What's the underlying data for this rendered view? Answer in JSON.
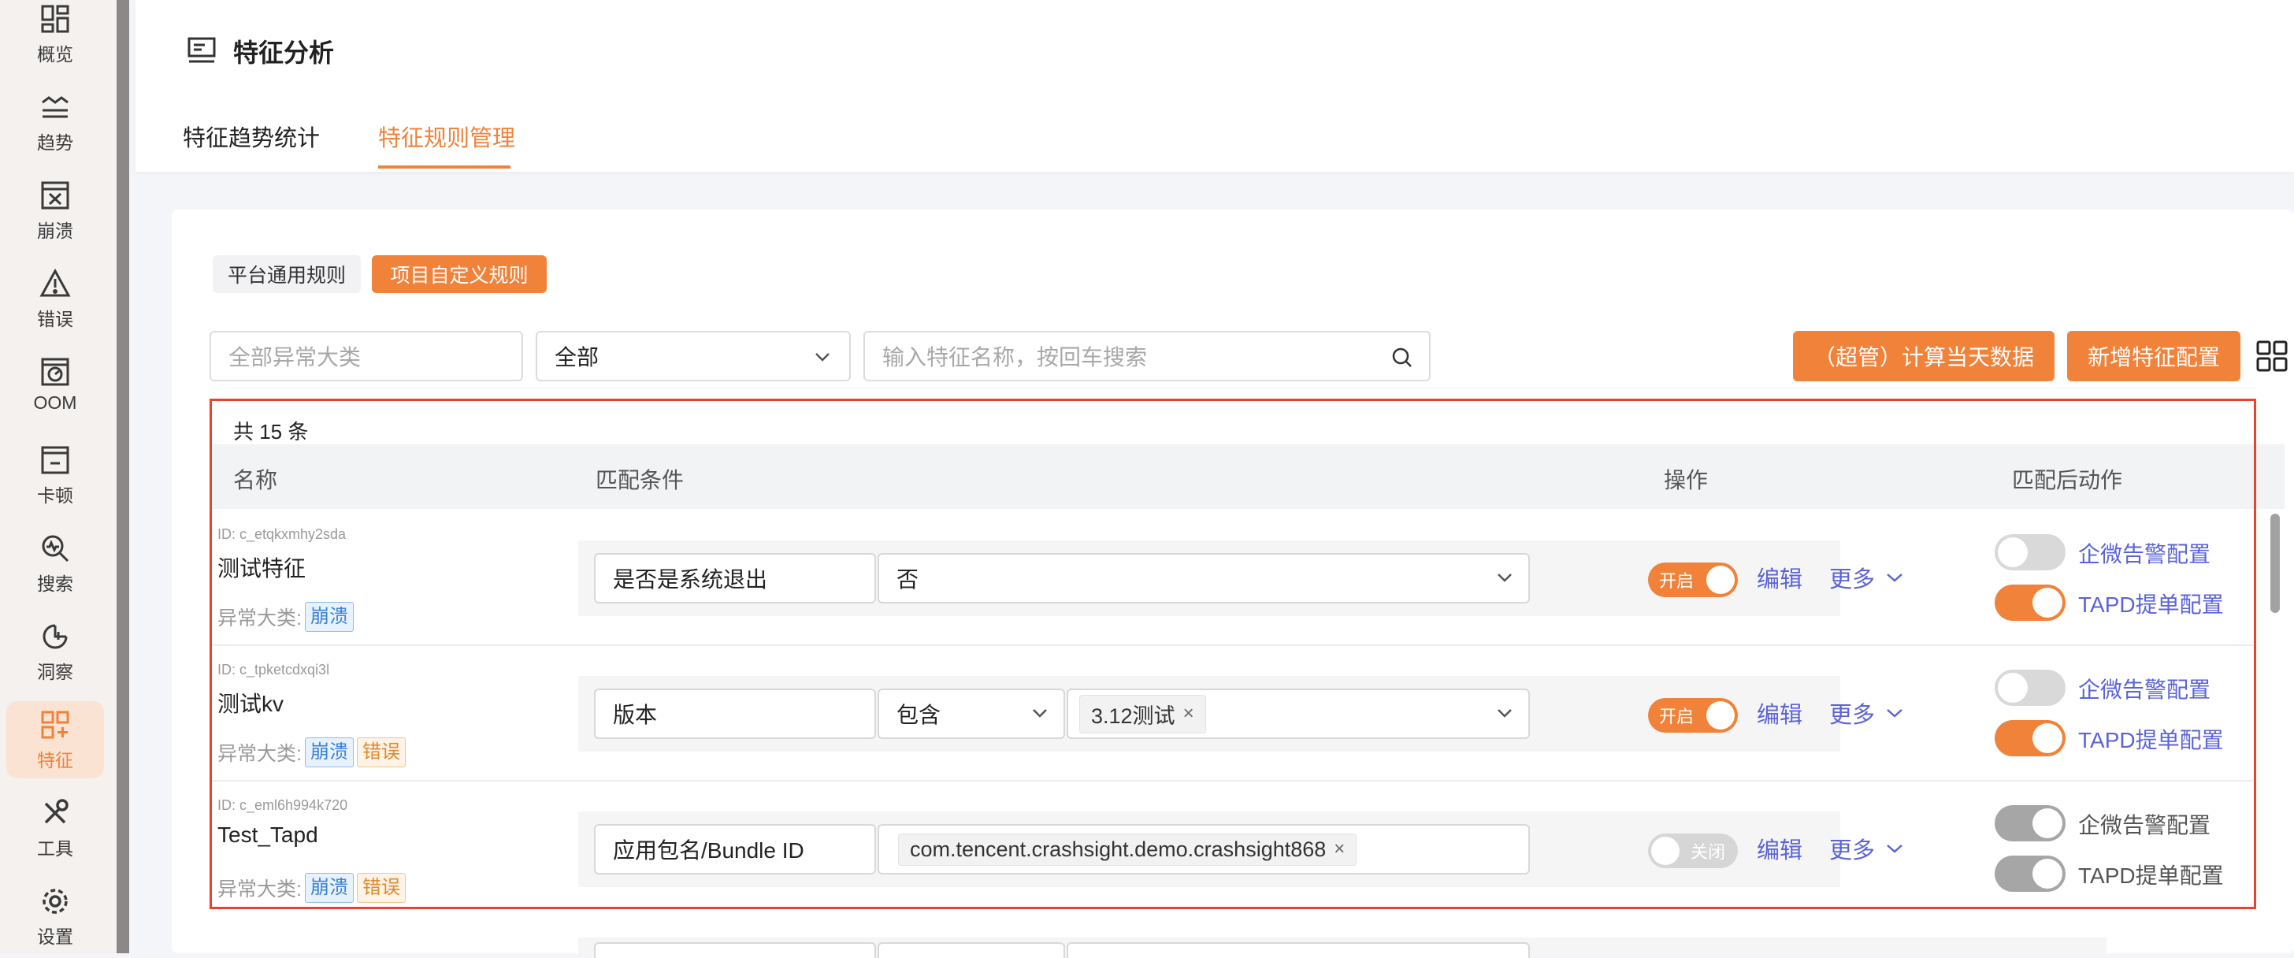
{
  "sidebar": {
    "items": [
      {
        "label": "概览",
        "icon": "overview-icon"
      },
      {
        "label": "趋势",
        "icon": "trend-icon"
      },
      {
        "label": "崩溃",
        "icon": "crash-icon"
      },
      {
        "label": "错误",
        "icon": "error-icon"
      },
      {
        "label": "OOM",
        "icon": "oom-icon"
      },
      {
        "label": "卡顿",
        "icon": "lag-icon"
      },
      {
        "label": "搜索",
        "icon": "search-icon"
      },
      {
        "label": "洞察",
        "icon": "insight-icon"
      },
      {
        "label": "特征",
        "icon": "feature-icon",
        "active": true
      },
      {
        "label": "工具",
        "icon": "tools-icon"
      },
      {
        "label": "设置",
        "icon": "settings-icon"
      }
    ]
  },
  "header": {
    "title": "特征分析",
    "tabs": [
      {
        "label": "特征趋势统计",
        "active": false
      },
      {
        "label": "特征规则管理",
        "active": true
      }
    ]
  },
  "segments": {
    "platform": "平台通用规则",
    "custom": "项目自定义规则"
  },
  "filters": {
    "category_placeholder": "全部异常大类",
    "select_value": "全部",
    "search_placeholder": "输入特征名称，按回车搜索"
  },
  "actions": {
    "compute": "（超管）计算当天数据",
    "add": "新增特征配置"
  },
  "table": {
    "count": "共 15 条",
    "headers": {
      "name": "名称",
      "condition": "匹配条件",
      "operation": "操作",
      "post_action": "匹配后动作"
    },
    "category_label": "异常大类:",
    "edit": "编辑",
    "more": "更多",
    "wecom": "企微告警配置",
    "tapd": "TAPD提单配置",
    "rows": [
      {
        "id": "ID: c_etqkxmhy2sda",
        "name": "测试特征",
        "badges": [
          "崩溃"
        ],
        "field": "是否是系统退出",
        "value": "否",
        "toggle": "开启"
      },
      {
        "id": "ID: c_tpketcdxqi3l",
        "name": "测试kv",
        "badges": [
          "崩溃",
          "错误"
        ],
        "field": "版本",
        "op": "包含",
        "tag": "3.12测试",
        "toggle": "开启"
      },
      {
        "id": "ID: c_eml6h994k720",
        "name": "Test_Tapd",
        "badges": [
          "崩溃",
          "错误"
        ],
        "field": "应用包名/Bundle ID",
        "tag": "com.tencent.crashsight.demo.crashsight868",
        "toggle": "关闭"
      }
    ]
  },
  "colors": {
    "accent": "#f0823a",
    "link": "#5b63d8",
    "highlight": "#e8432f"
  }
}
